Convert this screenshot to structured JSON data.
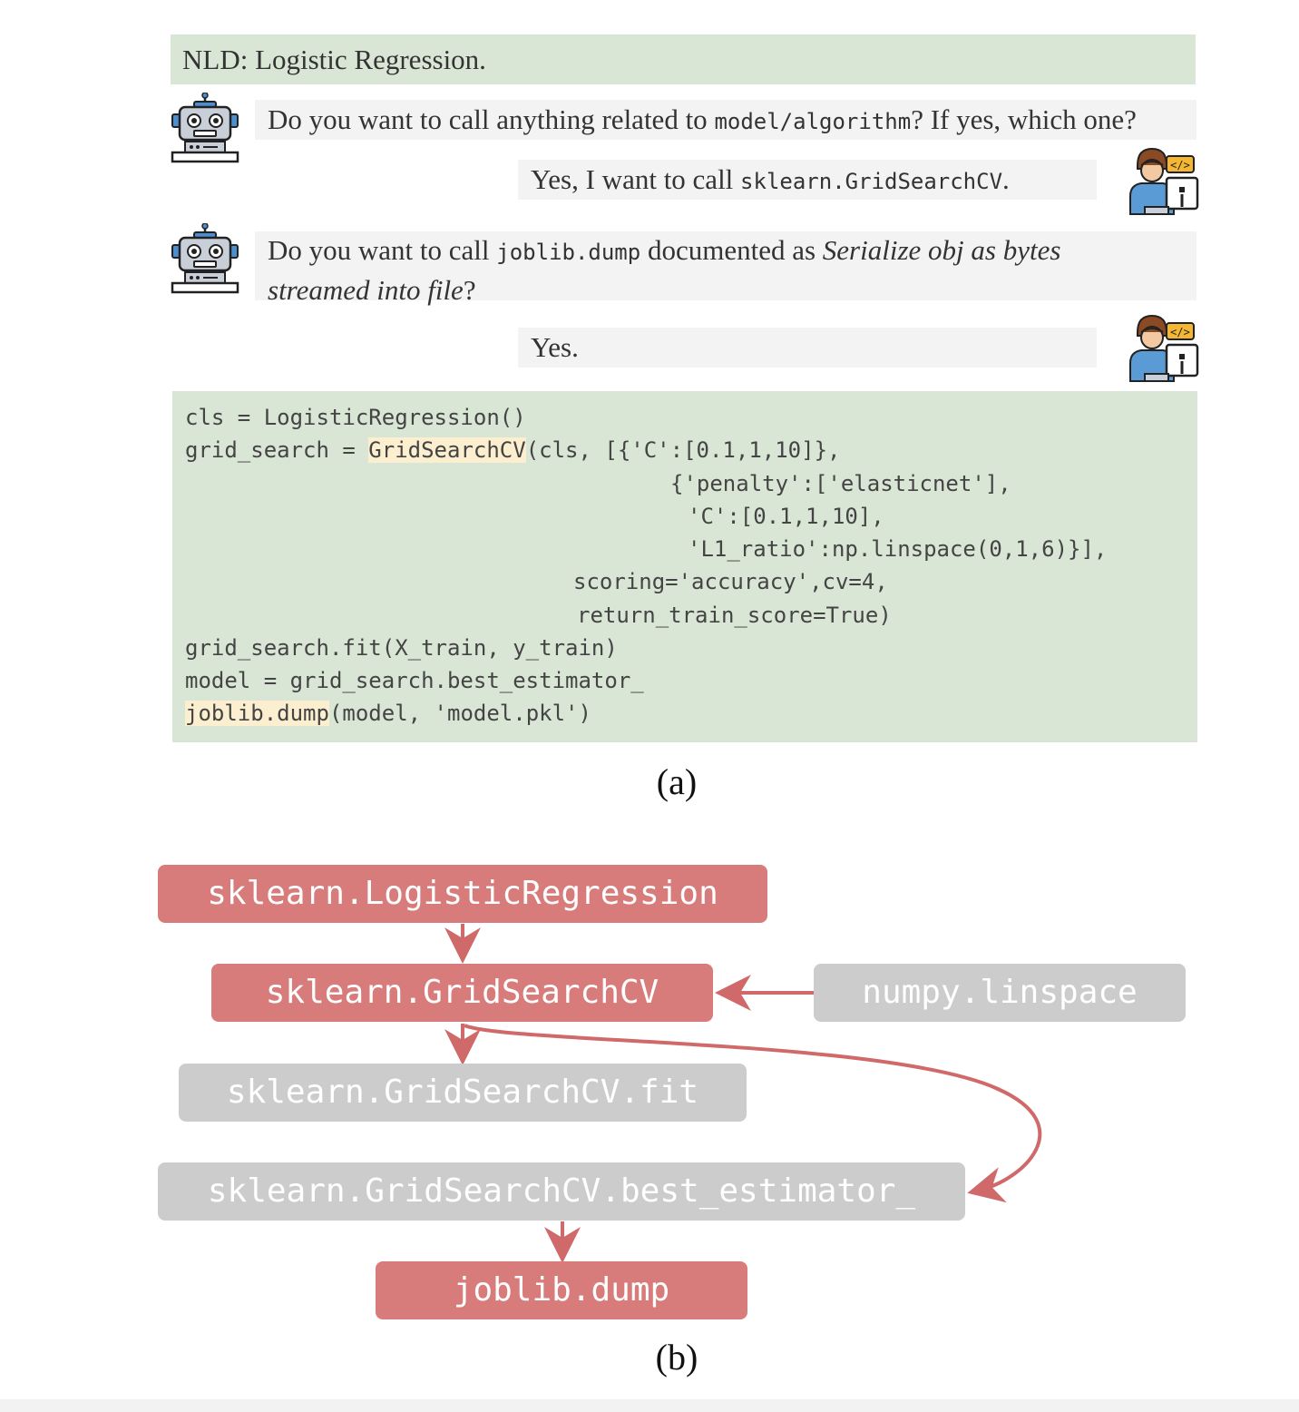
{
  "nld": "NLD: Logistic Regression.",
  "dialog": {
    "q1": {
      "pre": "Do you want to call anything related to ",
      "code": "model/algorithm",
      "post": "? If yes, which one?"
    },
    "a1": {
      "pre": "Yes, I want to call ",
      "code": "sklearn.GridSearchCV",
      "post": "."
    },
    "q2": {
      "pre": "Do you want to call ",
      "code": "joblib.dump",
      "mid": " documented as ",
      "italic1": "Serialize obj as bytes",
      "italic2": "streamed into file",
      "post": "?"
    },
    "a2": "Yes."
  },
  "code": {
    "l1": "cls = LogisticRegression()",
    "l2_pre": "grid_search = ",
    "l2_hl": "GridSearchCV",
    "l2_post": "(cls, [{'C':[0.1,1,10]},",
    "l3": "{'penalty':['elasticnet'],",
    "l4": "'C':[0.1,1,10],",
    "l5": "'L1_ratio':np.linspace(0,1,6)}],",
    "l6": "scoring='accuracy',cv=4,",
    "l7": "return_train_score=True)",
    "l8": "grid_search.fit(X_train, y_train)",
    "l9": "model = grid_search.best_estimator_",
    "l10_hl": "joblib.dump",
    "l10_post": "(model, 'model.pkl')"
  },
  "captions": {
    "a": "(a)",
    "b": "(b)"
  },
  "graph": {
    "nodes": {
      "logreg": "sklearn.LogisticRegression",
      "gridsearch": "sklearn.GridSearchCV",
      "linspace": "numpy.linspace",
      "fit": "sklearn.GridSearchCV.fit",
      "best": "sklearn.GridSearchCV.best_estimator_",
      "dump": "joblib.dump"
    }
  },
  "colors": {
    "selected": "#d77b7b",
    "unselected": "#cccccc",
    "edge": "#d06a6a",
    "green_bg": "#d9e6d5",
    "highlight": "#fbefcf"
  },
  "icons": {
    "assistant": "robot-icon",
    "user": "developer-icon"
  }
}
